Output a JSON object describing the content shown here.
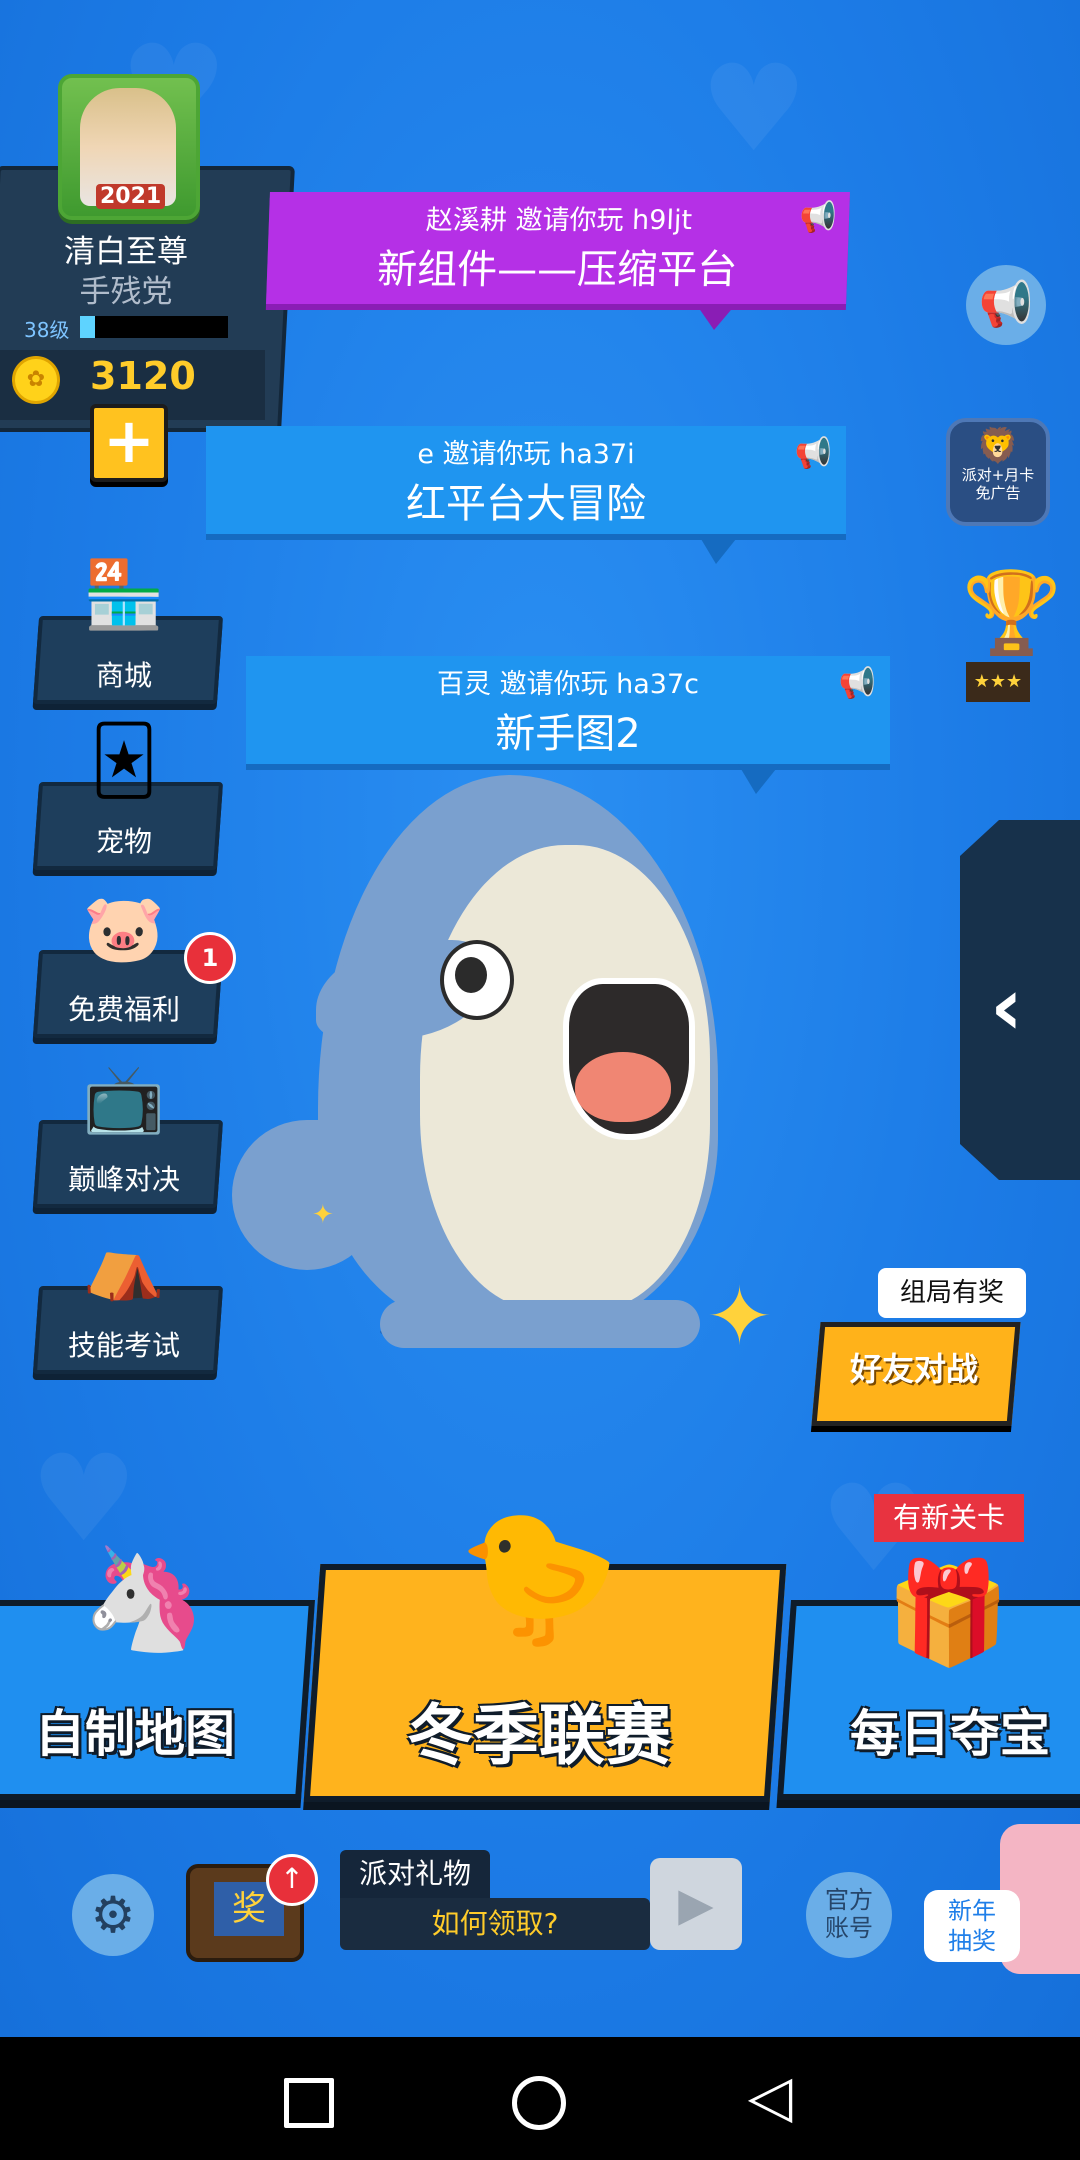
{
  "profile": {
    "name": "清白至尊",
    "title": "手残党",
    "level": "38级",
    "xp_fraction": 0.1,
    "coins": "3120",
    "avatar_badge": "2021"
  },
  "invites": [
    {
      "inviter": "赵溪耕 邀请你玩 h9ljt",
      "map": "新组件——压缩平台",
      "color": "#b530e6"
    },
    {
      "inviter": "e 邀请你玩 ha37i",
      "map": "红平台大冒险",
      "color": "#1f95f0"
    },
    {
      "inviter": "百灵 邀请你玩 ha37c",
      "map": "新手图2",
      "color": "#1f95f0"
    }
  ],
  "side_menu": [
    {
      "label": "商城",
      "icon": "shop-icon"
    },
    {
      "label": "宠物",
      "icon": "pet-cards-icon"
    },
    {
      "label": "免费福利",
      "icon": "piggy-bank-icon",
      "badge": "1"
    },
    {
      "label": "巅峰对决",
      "icon": "tv-icon"
    },
    {
      "label": "技能考试",
      "icon": "tent-icon"
    }
  ],
  "right": {
    "party_card_text": "派对+月卡\n免广告",
    "friend_battle": "好友对战",
    "friend_tooltip": "组局有奖"
  },
  "bottom_buttons": {
    "custom_map": "自制地图",
    "winter_league": "冬季联赛",
    "daily_treasure": "每日夺宝",
    "new_level_badge": "有新关卡"
  },
  "bottom_bar": {
    "gift_title": "派对礼物",
    "gift_question": "如何领取?",
    "official": "官方\n账号",
    "lottery": "新年\n抽奖",
    "reward_text": "奖"
  },
  "colors": {
    "background": "#1f7fe9",
    "panel": "#223c55",
    "accent_yellow": "#ffb31d",
    "badge_red": "#e8303a"
  }
}
